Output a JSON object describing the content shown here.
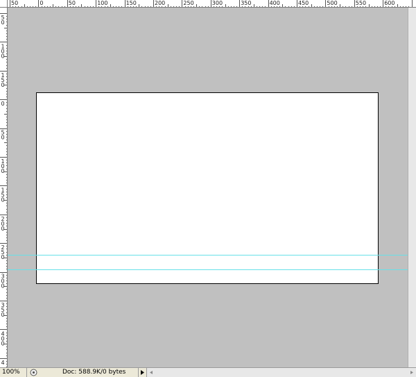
{
  "rulers": {
    "top": {
      "labels": [
        "50",
        "0",
        "50",
        "100",
        "150",
        "200",
        "250",
        "300",
        "350",
        "400",
        "450",
        "500",
        "550",
        "600"
      ]
    },
    "left": {
      "labels": [
        "50",
        "100",
        "150",
        "0",
        "50",
        "100",
        "150",
        "200",
        "250",
        "300",
        "350",
        "400",
        "450"
      ]
    }
  },
  "status_bar": {
    "zoom": "100%",
    "doc_info": "Doc: 588.9K/0 bytes"
  },
  "colors": {
    "workspace": "#c0c0c0",
    "guide": "#66e0e8",
    "document": "#ffffff"
  },
  "icons": {
    "status": "status-menu-icon",
    "arrow": "triangle-right-icon",
    "scroll_left": "arrow-left-icon",
    "scroll_right": "arrow-right-icon"
  }
}
